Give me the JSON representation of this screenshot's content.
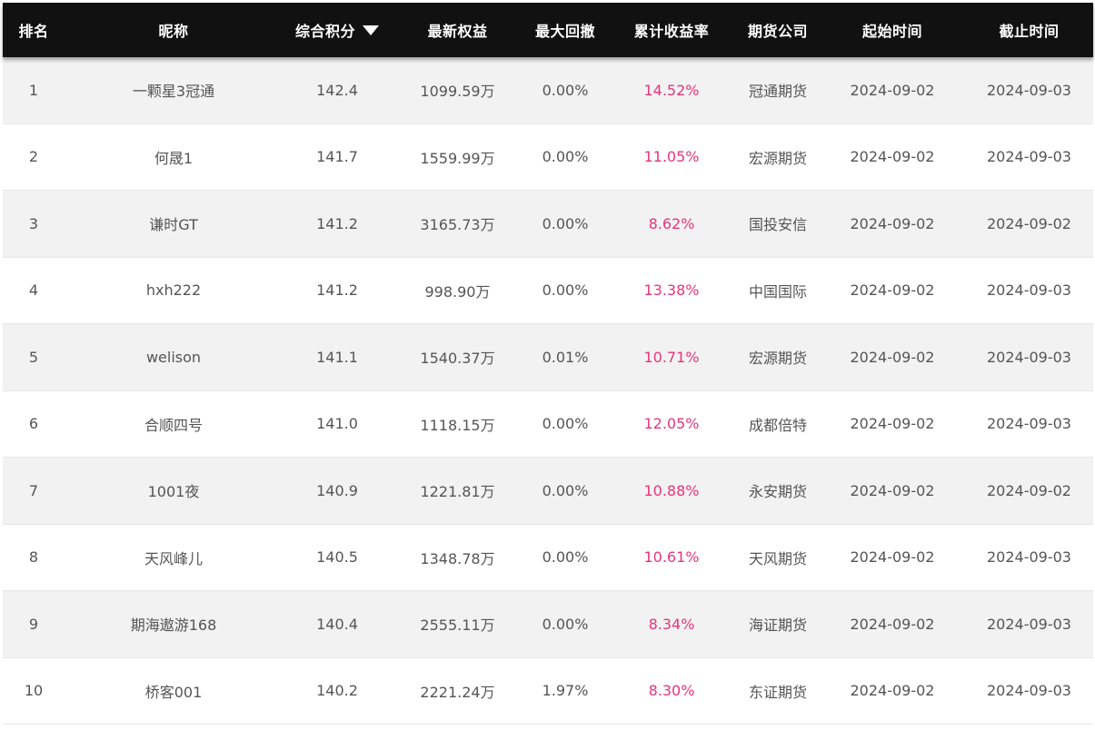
{
  "table": {
    "headers": {
      "rank": "排名",
      "nickname": "昵称",
      "score": "综合积分",
      "equity": "最新权益",
      "drawdown": "最大回撤",
      "return_rate": "累计收益率",
      "company": "期货公司",
      "start": "起始时间",
      "end": "截止时间"
    },
    "sort_icon": "sort-desc-icon",
    "accent_color": "#e6357d",
    "header_bg": "#111111",
    "rows": [
      {
        "rank": "1",
        "nickname": "一颗星3冠通",
        "score": "142.4",
        "equity": "1099.59万",
        "drawdown": "0.00%",
        "return_rate": "14.52%",
        "company": "冠通期货",
        "start": "2024-09-02",
        "end": "2024-09-03"
      },
      {
        "rank": "2",
        "nickname": "何晟1",
        "score": "141.7",
        "equity": "1559.99万",
        "drawdown": "0.00%",
        "return_rate": "11.05%",
        "company": "宏源期货",
        "start": "2024-09-02",
        "end": "2024-09-03"
      },
      {
        "rank": "3",
        "nickname": "谦时GT",
        "score": "141.2",
        "equity": "3165.73万",
        "drawdown": "0.00%",
        "return_rate": "8.62%",
        "company": "国投安信",
        "start": "2024-09-02",
        "end": "2024-09-02"
      },
      {
        "rank": "4",
        "nickname": "hxh222",
        "score": "141.2",
        "equity": "998.90万",
        "drawdown": "0.00%",
        "return_rate": "13.38%",
        "company": "中国国际",
        "start": "2024-09-02",
        "end": "2024-09-03"
      },
      {
        "rank": "5",
        "nickname": "welison",
        "score": "141.1",
        "equity": "1540.37万",
        "drawdown": "0.01%",
        "return_rate": "10.71%",
        "company": "宏源期货",
        "start": "2024-09-02",
        "end": "2024-09-03"
      },
      {
        "rank": "6",
        "nickname": "合顺四号",
        "score": "141.0",
        "equity": "1118.15万",
        "drawdown": "0.00%",
        "return_rate": "12.05%",
        "company": "成都倍特",
        "start": "2024-09-02",
        "end": "2024-09-03"
      },
      {
        "rank": "7",
        "nickname": "1001夜",
        "score": "140.9",
        "equity": "1221.81万",
        "drawdown": "0.00%",
        "return_rate": "10.88%",
        "company": "永安期货",
        "start": "2024-09-02",
        "end": "2024-09-02"
      },
      {
        "rank": "8",
        "nickname": "天风峰儿",
        "score": "140.5",
        "equity": "1348.78万",
        "drawdown": "0.00%",
        "return_rate": "10.61%",
        "company": "天风期货",
        "start": "2024-09-02",
        "end": "2024-09-03"
      },
      {
        "rank": "9",
        "nickname": "期海遨游168",
        "score": "140.4",
        "equity": "2555.11万",
        "drawdown": "0.00%",
        "return_rate": "8.34%",
        "company": "海证期货",
        "start": "2024-09-02",
        "end": "2024-09-03"
      },
      {
        "rank": "10",
        "nickname": "桥客001",
        "score": "140.2",
        "equity": "2221.24万",
        "drawdown": "1.97%",
        "return_rate": "8.30%",
        "company": "东证期货",
        "start": "2024-09-02",
        "end": "2024-09-03"
      }
    ]
  }
}
